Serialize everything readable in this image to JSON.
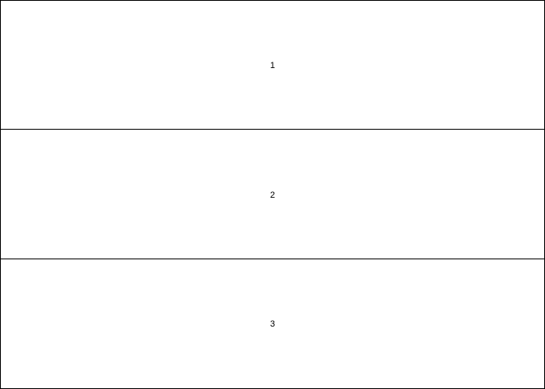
{
  "panels": [
    {
      "label": "1"
    },
    {
      "label": "2"
    },
    {
      "label": "3"
    }
  ],
  "colors": {
    "border": "#000000",
    "background": "#ffffff",
    "text": "#000000"
  }
}
